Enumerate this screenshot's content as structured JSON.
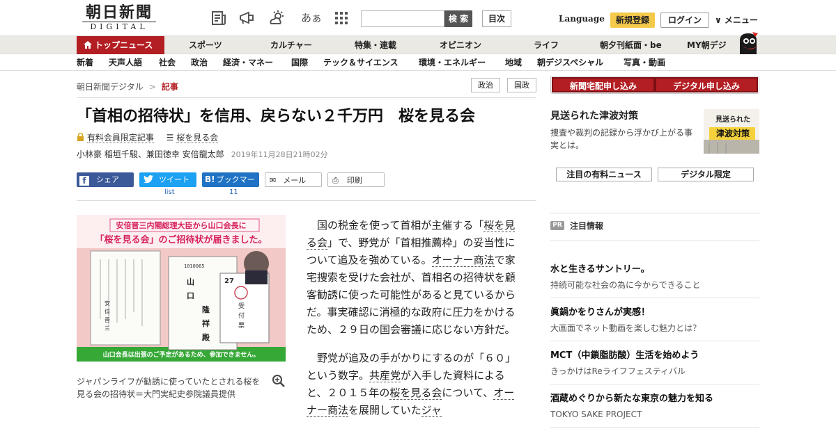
{
  "header": {
    "logo_kanji": "朝日新聞",
    "logo_sub": "DIGITAL",
    "search_button": "検 索",
    "toc_button": "目次",
    "language": "Language",
    "register": "新規登録",
    "login": "ログイン",
    "menu": "∨ メニュー",
    "kana_icon": "あぁ"
  },
  "nav_primary": [
    "トップニュース",
    "スポーツ",
    "カルチャー",
    "特集・連載",
    "オピニオン",
    "ライフ",
    "朝夕刊紙面・be",
    "MY朝デジ"
  ],
  "nav_secondary": [
    "新着",
    "天声人語",
    "社会",
    "政治",
    "経済・マネー",
    "国際",
    "テック＆サイエンス",
    "環境・エネルギー",
    "地域",
    "朝デジスペシャル",
    "写真・動画"
  ],
  "breadcrumb": {
    "home": "朝日新聞デジタル",
    "sep": ">",
    "current": "記事"
  },
  "tags": [
    "政治",
    "国政"
  ],
  "article": {
    "headline": "「首相の招待状」を信用、戻らない２千万円　桜を見る会",
    "members_only": "有料会員限定記事",
    "topic": "桜を見る会",
    "authors": "小林豪 稲垣千駿、兼田徳幸 安倍龍太郎",
    "date": "2019年11月28日21時02分",
    "share": {
      "facebook": "シェア",
      "twitter": "ツイート",
      "hatena": "ブックマーク",
      "mail": "メール",
      "print": "印刷",
      "twitter_count": "list",
      "hatena_count": "11"
    },
    "photo": {
      "banner_line1": "安倍晋三内閣総理大臣から山口会長に",
      "banner_line2": "「桜を見る会」のご招待状が届きました。",
      "bottom_line": "山口会長は出張のご予定があるため、参加できません。",
      "name_main": "山口隆祥殿",
      "card_number": "27",
      "reception": "受付票",
      "postal": "1010065",
      "sender": "安倍晋三"
    },
    "caption": "ジャパンライフが勧誘に使っていたとされる桜を見る会の招待状＝大門実紀史参院議員提供",
    "p1": {
      "a": "国の税金を使って首相が主催する「",
      "t1": "桜を見る会",
      "b": "」で、野党が「首相推薦枠」の妥当性について追及を強めている。",
      "t2": "オーナー商法",
      "c": "で家宅捜索を受けた会社が、首相名の招待状を顧客勧誘に使った可能性があると見ているからだ。事実確認に消極的な政府に圧力をかけるため、２９日の国会審議に応じない方針だ。"
    },
    "p2": {
      "a": "野党が追及の手がかりにするのが「６０」という数字。",
      "t1": "共産党",
      "b": "が入手した資料によると、２０１５年の",
      "t2": "桜を見る会",
      "c": "について、",
      "t3": "オーナー商法",
      "d": "を展開していた",
      "t4": "ジャ"
    }
  },
  "sidebar": {
    "subscribe_paper": "新聞宅配申し込み",
    "subscribe_digital": "デジタル申し込み",
    "feature_title": "見送られた津波対策",
    "feature_desc": "捜査や裁判の記録から浮かび上がる事実とは。",
    "feature_thumb_line1": "見送られた",
    "feature_thumb_line2": "津波対策",
    "tab_paid": "注目の有料ニュース",
    "tab_digital": "デジタル限定",
    "pr_badge": "PR",
    "notice_head": "注目情報",
    "ads": [
      {
        "title": "水と生きるサントリー。",
        "desc": "持続可能な社会の為に今からできること"
      },
      {
        "title": "眞鍋かをりさんが実感！",
        "desc": "大画面でネット動画を楽しむ魅力とは？"
      },
      {
        "title": "MCT（中鎖脂肪酸）生活を始めよう",
        "desc": "きっかけはReライフフェスティバル"
      },
      {
        "title": "酒蔵めぐりから新たな東京の魅力を知る",
        "desc": "TOKYO SAKE PROJECT"
      }
    ]
  },
  "colors": {
    "brand_red": "#b31e23",
    "nav_bg": "#ebe9e3",
    "accent_yellow": "#f5c94a",
    "facebook": "#3b5998",
    "twitter": "#1da1f2",
    "hatena": "#1f72c4"
  },
  "icons": [
    "newspaper-icon",
    "megaphone-icon",
    "weather-icon",
    "kana-icon",
    "grid-icon",
    "home-icon",
    "lock-icon",
    "list-icon",
    "zoom-icon",
    "mascot-icon"
  ]
}
